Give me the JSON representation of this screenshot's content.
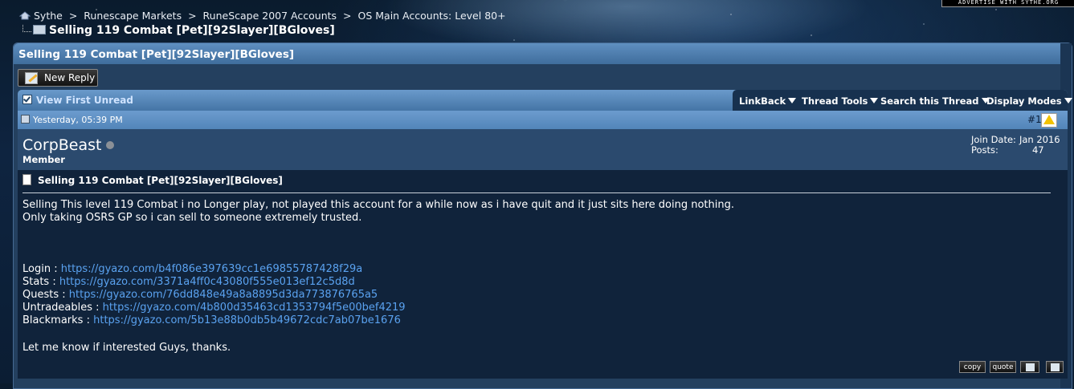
{
  "ad_text": "ADVERTISE WITH SYTHE.ORG",
  "breadcrumb": {
    "items": [
      "Sythe",
      "Runescape Markets",
      "RuneScape 2007 Accounts",
      "OS Main Accounts: Level 80+"
    ],
    "separator": ">",
    "current": "Selling 119 Combat [Pet][92Slayer][BGloves]"
  },
  "thread": {
    "title": "Selling 119 Combat [Pet][92Slayer][BGloves]",
    "new_reply": "New Reply",
    "view_first_unread": "View First Unread",
    "tools": [
      "LinkBack",
      "Thread Tools",
      "Search this Thread",
      "Display Modes"
    ]
  },
  "post": {
    "date": "Yesterday, 05:39 PM",
    "number": "#1",
    "username": "CorpBeast",
    "user_title": "Member",
    "join_label": "Join Date:",
    "join_value": "Jan 2016",
    "posts_label": "Posts:",
    "posts_value": "47",
    "title": "Selling 119 Combat [Pet][92Slayer][BGloves]",
    "line1": "Selling This level 119 Combat i no Longer play, not played this account for a while now as i have quit and it just sits here doing nothing.",
    "line2": "Only taking OSRS GP so i can sell to someone extremely trusted.",
    "links": [
      {
        "label": "Login :",
        "url": "https://gyazo.com/b4f086e397639cc1e69855787428f29a"
      },
      {
        "label": "Stats :",
        "url": "https://gyazo.com/3371a4ff0c43080f555e013ef12c5d8d"
      },
      {
        "label": "Quests :",
        "url": "https://gyazo.com/76dd848e49a8a8895d3da773876765a5"
      },
      {
        "label": "Untradeables :",
        "url": "https://gyazo.com/4b800d35463cd1353794f5e00bef4219"
      },
      {
        "label": "Blackmarks :",
        "url": "https://gyazo.com/5b13e88b0db5b49672cdc7ab07be1676"
      }
    ],
    "closing": "Let me know if interested Guys, thanks.",
    "copy_label": "copy",
    "quote_label": "quote"
  },
  "icons": [
    "home-icon",
    "folder-icon",
    "new-reply-icon",
    "checkbox-icon",
    "dropdown-arrow-icon",
    "post-icon",
    "warning-icon",
    "offline-status-icon",
    "document-icon",
    "multiquote-icon",
    "quick-reply-icon"
  ],
  "colors": {
    "header_blue": "#4f7fb0",
    "link_blue": "#5aa2f0",
    "post_bg": "#10233b",
    "warning_yellow": "#f2c200"
  }
}
